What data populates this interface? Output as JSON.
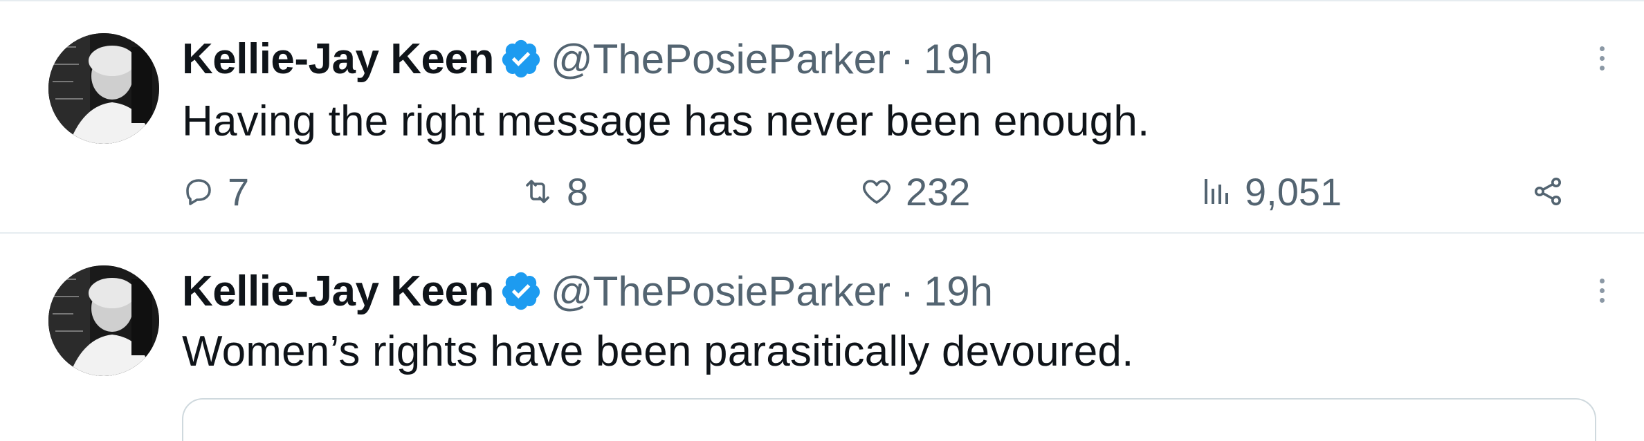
{
  "colors": {
    "text": "#0f1419",
    "muted": "#536471",
    "verified": "#1d9bf0",
    "border": "#e6ecf0"
  },
  "tweets": [
    {
      "name": "Kellie-Jay Keen",
      "handle": "@ThePosieParker",
      "separator": "·",
      "time": "19h",
      "text": "Having the right message has never been enough.",
      "actions": {
        "replies": "7",
        "retweets": "8",
        "likes": "232",
        "views": "9,051"
      }
    },
    {
      "name": "Kellie-Jay Keen",
      "handle": "@ThePosieParker",
      "separator": "·",
      "time": "19h",
      "text": "Women’s rights have been parasitically devoured."
    }
  ]
}
